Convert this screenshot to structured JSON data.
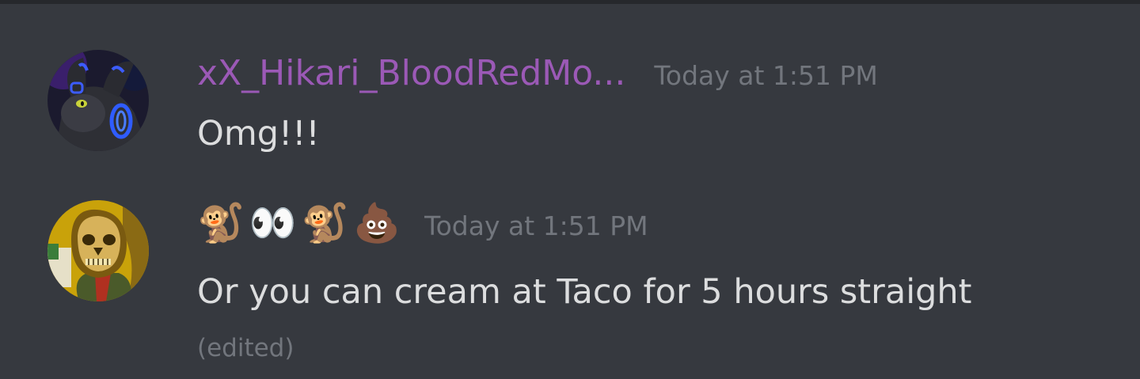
{
  "messages": [
    {
      "author": "xX_Hikari_BloodRedMo...",
      "timestamp": "Today at 1:51 PM",
      "content": "Omg!!!"
    },
    {
      "author_emojis": [
        "🐒",
        "👀",
        "🐒",
        "💩"
      ],
      "timestamp": "Today at 1:51 PM",
      "content": "Or you can cream at Taco for 5 hours straight",
      "edited_label": "(edited)"
    }
  ],
  "colors": {
    "background": "#36393f",
    "username_accent": "#9b59b6",
    "text": "#dcddde",
    "muted": "#72767d"
  }
}
